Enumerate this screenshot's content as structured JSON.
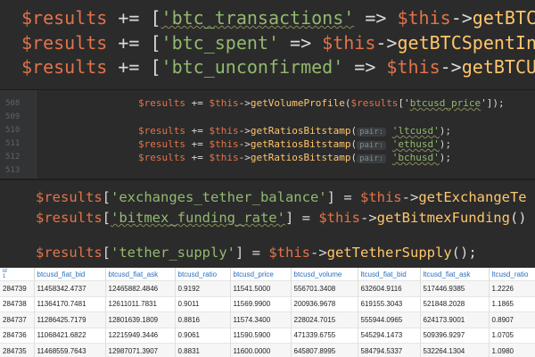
{
  "top_code": {
    "lines": [
      {
        "var": "$results",
        "op": " += [",
        "key": "'btc_transactions'",
        "arrow": " => ",
        "this": "$this",
        "fn_arrow": "->",
        "fn": "getBTC"
      },
      {
        "var": "$results",
        "op": " += [",
        "key": "'btc_spent'",
        "arrow": " => ",
        "this": "$this",
        "fn_arrow": "->",
        "fn": "getBTCSpentIn"
      },
      {
        "var": "$results",
        "op": " += [",
        "key": "'btc_unconfirmed'",
        "arrow": " => ",
        "this": "$this",
        "fn_arrow": "->",
        "fn": "getBTCU"
      }
    ]
  },
  "mid_code": {
    "line_numbers": [
      "508",
      "509",
      "510",
      "511",
      "512",
      "513"
    ],
    "line_508": {
      "var": "$results",
      "op": " += ",
      "this": "$this",
      "arr": "->",
      "fn": "getVolumeProfile",
      "open": "(",
      "var2": "$results",
      "idx_open": "['",
      "key": "btcusd_price",
      "idx_close": "']",
      "close": ");"
    },
    "ratio_lines": [
      {
        "var": "$results",
        "op": " += ",
        "this": "$this",
        "arr": "->",
        "fn": "getRatiosBitstamp",
        "open": "(",
        "hint": "pair:",
        "arg": "'ltcusd'",
        "close": ");"
      },
      {
        "var": "$results",
        "op": " += ",
        "this": "$this",
        "arr": "->",
        "fn": "getRatiosBitstamp",
        "open": "(",
        "hint": "pair:",
        "arg": "'ethusd'",
        "close": ");"
      },
      {
        "var": "$results",
        "op": " += ",
        "this": "$this",
        "arr": "->",
        "fn": "getRatiosBitstamp",
        "open": "(",
        "hint": "pair:",
        "arg": "'bchusd'",
        "close": ");"
      }
    ]
  },
  "bottom_code": {
    "lines": [
      {
        "var": "$results",
        "open": "[",
        "key": "'exchanges_tether_balance'",
        "close": "]",
        "eq": " = ",
        "this": "$this",
        "arr": "->",
        "fn": "getExchangeTe"
      },
      {
        "var": "$results",
        "open": "[",
        "key": "'bitmex_funding_rate'",
        "close": "]",
        "eq": " = ",
        "this": "$this",
        "arr": "->",
        "fn": "getBitmexFunding",
        "tail": "()"
      },
      {
        "var": "$results",
        "open": "[",
        "key": "'tether_supply'",
        "close": "]",
        "eq": " = ",
        "this": "$this",
        "arr": "->",
        "fn": "getTetherSupply",
        "tail": "();"
      }
    ]
  },
  "table": {
    "headers": [
      "id\n1",
      "btcusd_fiat_bid",
      "btcusd_fiat_ask",
      "btcusd_ratio",
      "btcusd_price",
      "btcusd_volume",
      "ltcusd_fiat_bid",
      "ltcusd_fiat_ask",
      "ltcusd_ratio"
    ],
    "rows": [
      [
        "284739",
        "11458342.4737",
        "12465882.4846",
        "0.9192",
        "11541.5000",
        "556701.3408",
        "632604.9116",
        "517446.9385",
        "1.2226"
      ],
      [
        "284738",
        "11364170.7481",
        "12611011.7831",
        "0.9011",
        "11569.9900",
        "200936.9678",
        "619155.3043",
        "521848.2028",
        "1.1865"
      ],
      [
        "284737",
        "11286425.7179",
        "12801639.1809",
        "0.8816",
        "11574.3400",
        "228024.7015",
        "555944.0965",
        "624173.9001",
        "0.8907"
      ],
      [
        "284736",
        "11068421.6822",
        "12215949.3446",
        "0.9061",
        "11590.5900",
        "471339.6755",
        "545294.1473",
        "509396.9297",
        "1.0705"
      ],
      [
        "284735",
        "11468559.7643",
        "12987071.3907",
        "0.8831",
        "11600.0000",
        "645807.8995",
        "584794.5337",
        "532264.1304",
        "1.0980"
      ]
    ]
  }
}
